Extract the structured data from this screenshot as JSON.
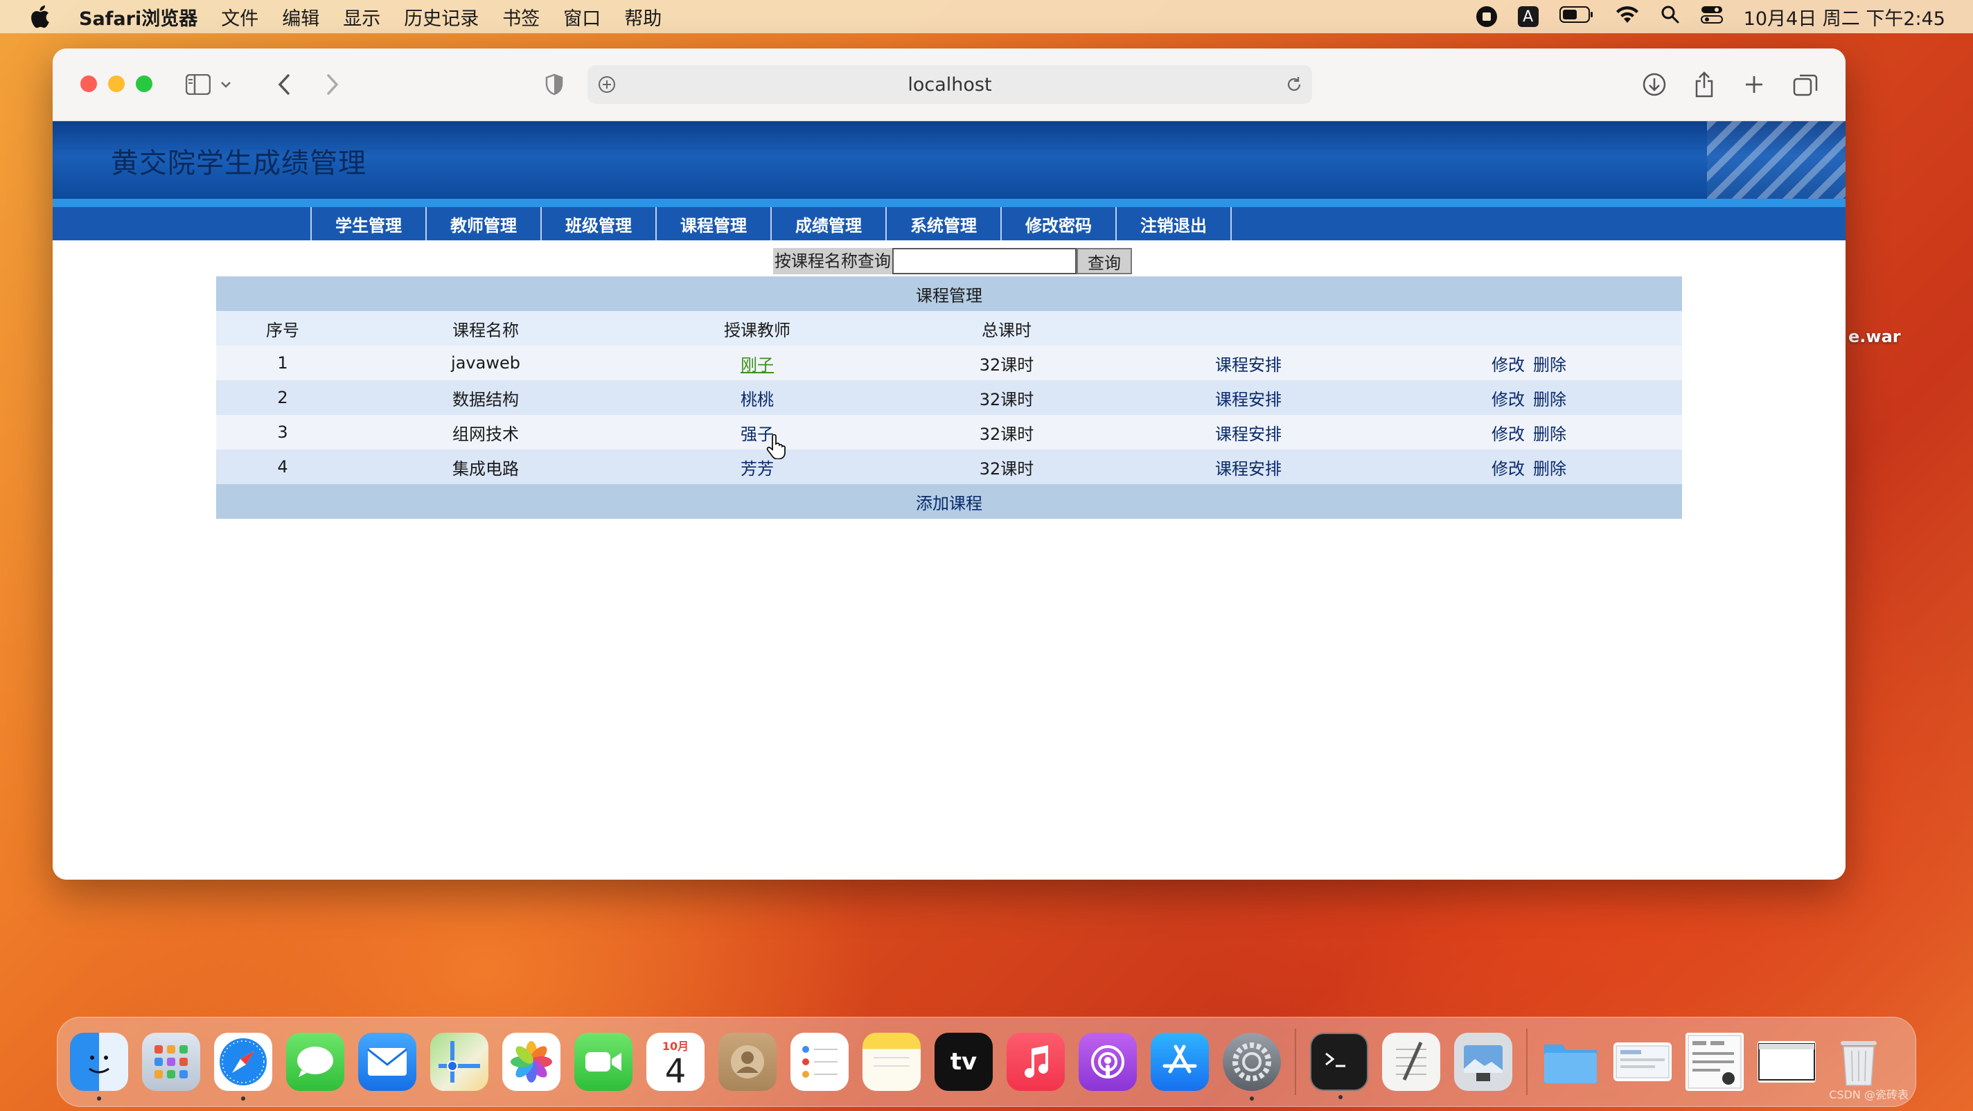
{
  "menubar": {
    "app": "Safari浏览器",
    "items": [
      "文件",
      "编辑",
      "显示",
      "历史记录",
      "书签",
      "窗口",
      "帮助"
    ],
    "status_a": "A",
    "datetime": "10月4日 周二 下午2:45"
  },
  "browser": {
    "url": "localhost"
  },
  "site": {
    "title": "黄交院学生成绩管理",
    "nav": [
      "学生管理",
      "教师管理",
      "班级管理",
      "课程管理",
      "成绩管理",
      "系统管理",
      "修改密码",
      "注销退出"
    ]
  },
  "search": {
    "label": "按课程名称查询",
    "value": "",
    "button": "查询"
  },
  "table": {
    "caption": "课程管理",
    "headers": [
      "序号",
      "课程名称",
      "授课教师",
      "总课时"
    ],
    "rows": [
      {
        "id": "1",
        "name": "javaweb",
        "teacher": "刚子",
        "hours": "32课时",
        "schedule": "课程安排",
        "edit": "修改",
        "delete": "删除"
      },
      {
        "id": "2",
        "name": "数据结构",
        "teacher": "桃桃",
        "hours": "32课时",
        "schedule": "课程安排",
        "edit": "修改",
        "delete": "删除"
      },
      {
        "id": "3",
        "name": "组网技术",
        "teacher": "强子",
        "hours": "32课时",
        "schedule": "课程安排",
        "edit": "修改",
        "delete": "删除"
      },
      {
        "id": "4",
        "name": "集成电路",
        "teacher": "芳芳",
        "hours": "32课时",
        "schedule": "课程安排",
        "edit": "修改",
        "delete": "删除"
      }
    ],
    "add_label": "添加课程"
  },
  "desktop": {
    "war_label": "e.war",
    "watermark": "CSDN @瓷砖表"
  },
  "dock": {
    "calendar_month": "10月",
    "calendar_day": "4",
    "tv_label": "tv"
  }
}
